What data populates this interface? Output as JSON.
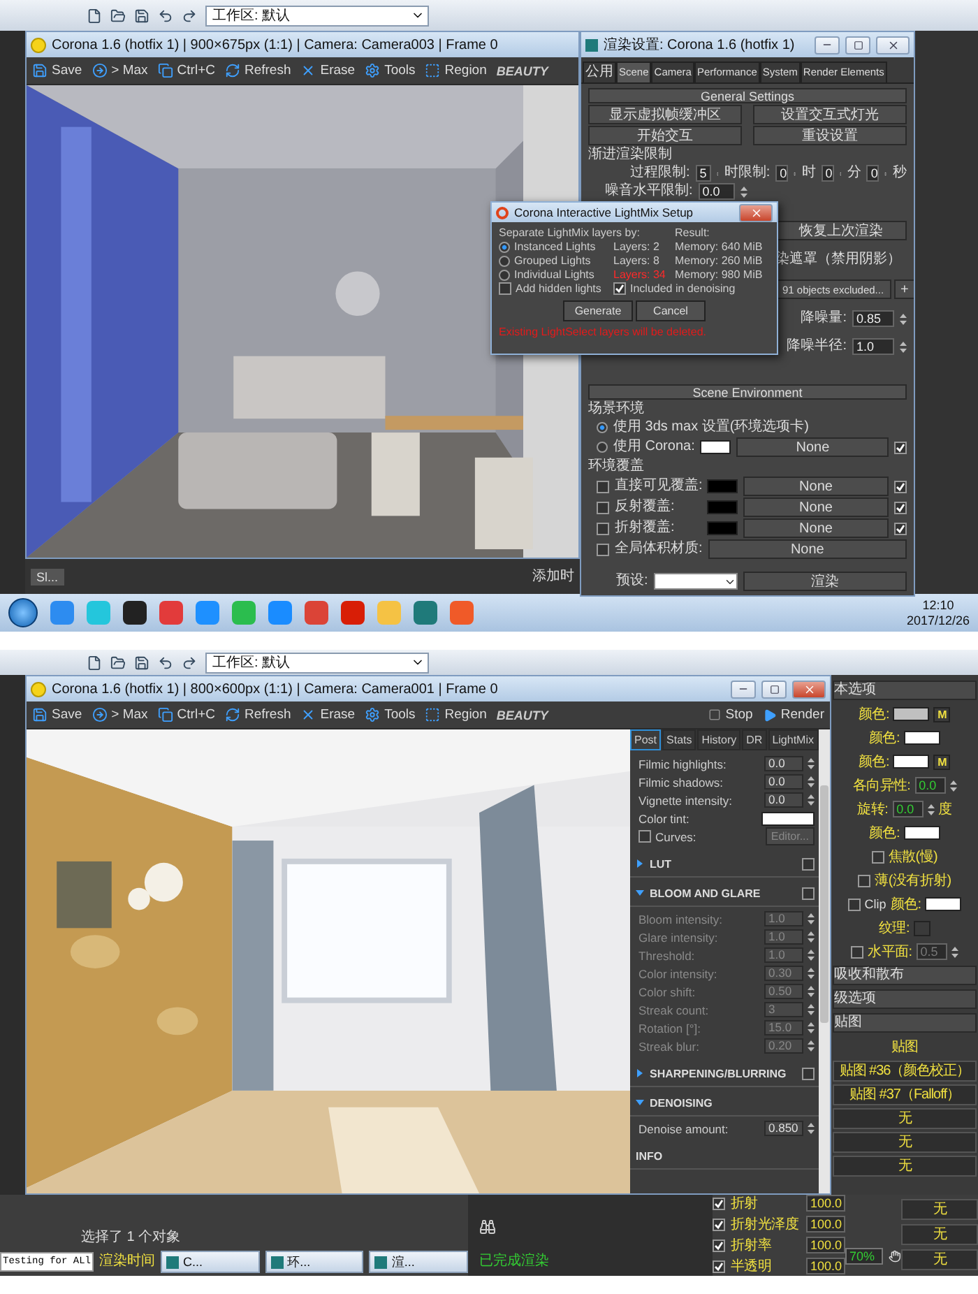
{
  "top_screen": {
    "workspace": "工作区: 默认",
    "vfb": {
      "title": "Corona 1.6 (hotfix 1) | 900×675px (1:1) | Camera: Camera003 | Frame 0",
      "toolbar": [
        {
          "kind": "save",
          "label": "Save"
        },
        {
          "kind": "max",
          "label": "> Max"
        },
        {
          "kind": "copy",
          "label": "Ctrl+C"
        },
        {
          "kind": "refresh",
          "label": "Refresh"
        },
        {
          "kind": "erase",
          "label": "Erase"
        },
        {
          "kind": "tools",
          "label": "Tools"
        },
        {
          "kind": "region",
          "label": "Region"
        }
      ],
      "channel": "BEAUTY"
    },
    "status": {
      "left_tab": "Sl...",
      "right_label": "添加时"
    },
    "render_setup": {
      "title": "渲染设置: Corona 1.6 (hotfix 1)",
      "tabs": [
        {
          "label": "公用",
          "selected": false
        },
        {
          "label": "Scene",
          "selected": true
        },
        {
          "label": "Camera",
          "selected": false
        },
        {
          "label": "Performance",
          "selected": false
        },
        {
          "label": "System",
          "selected": false
        },
        {
          "label": "Render Elements",
          "selected": false
        }
      ],
      "general": {
        "heading": "General Settings",
        "buttons": [
          "显示虚拟帧缓冲区",
          "设置交互式灯光",
          "开始交互",
          "重设设置"
        ],
        "limits_label": "渐进渲染限制",
        "pass_label": "过程限制:",
        "pass_value": "5",
        "time_label": "时限制:",
        "time_fields": [
          {
            "value": "0",
            "unit": "时"
          },
          {
            "value": "0",
            "unit": "分"
          },
          {
            "value": "0",
            "unit": "秒"
          }
        ],
        "noise_label": "噪音水平限制:",
        "noise_value": "0.0",
        "restore_button": "恢复上次渲染",
        "mask_label": "染遮罩（禁用阴影）",
        "excluded_button": "91 objects excluded...",
        "add_button": "+",
        "denoise": [
          {
            "label": "降噪量:",
            "value": "0.85"
          },
          {
            "label": "降噪半径:",
            "value": "1.0"
          }
        ]
      },
      "environment": {
        "heading": "Scene Environment",
        "group_label": "场景环境",
        "options": [
          {
            "label": "使用 3ds max 设置(环境选项卡)",
            "selected": true
          },
          {
            "label": "使用 Corona:",
            "selected": false
          }
        ],
        "corona_map": "None",
        "corona_map_checked": true,
        "override_label": "环境覆盖",
        "overrides": [
          {
            "label": "直接可见覆盖:",
            "checked": false,
            "map": "None",
            "map_checked": true
          },
          {
            "label": "反射覆盖:",
            "checked": false,
            "map": "None",
            "map_checked": true
          },
          {
            "label": "折射覆盖:",
            "checked": false,
            "map": "None",
            "map_checked": true
          }
        ],
        "volume": {
          "label": "全局体积材质:",
          "checked": false,
          "map": "None"
        }
      },
      "preset_label": "预设:",
      "render_button": "渲染"
    },
    "dialog": {
      "title": "Corona Interactive LightMix Setup",
      "prompt": "Separate LightMix layers by:",
      "result_label": "Result:",
      "options": [
        {
          "label": "Instanced Lights",
          "selected": true,
          "layers": "Layers: 2",
          "memory": "Memory: 640 MiB",
          "warning": false
        },
        {
          "label": "Grouped Lights",
          "selected": false,
          "layers": "Layers: 8",
          "memory": "Memory: 260 MiB",
          "warning": false
        },
        {
          "label": "Individual Lights",
          "selected": false,
          "layers": "Layers: 34",
          "memory": "Memory: 980 MiB",
          "warning": true
        }
      ],
      "add_hidden": {
        "label": "Add hidden lights",
        "checked": false
      },
      "denoising": {
        "label": "Included in denoising",
        "checked": true
      },
      "buttons": [
        "Generate",
        "Cancel"
      ],
      "message": "Existing LightSelect layers will be deleted."
    },
    "taskbar": {
      "time": "12:10",
      "date": "2017/12/26"
    }
  },
  "bottom_screen": {
    "workspace": "工作区: 默认",
    "vfb": {
      "title": "Corona 1.6 (hotfix 1) | 800×600px (1:1) | Camera: Camera001 | Frame 0",
      "toolbar": [
        {
          "kind": "save",
          "label": "Save"
        },
        {
          "kind": "max",
          "label": "> Max"
        },
        {
          "kind": "copy",
          "label": "Ctrl+C"
        },
        {
          "kind": "refresh",
          "label": "Refresh"
        },
        {
          "kind": "erase",
          "label": "Erase"
        },
        {
          "kind": "tools",
          "label": "Tools"
        },
        {
          "kind": "region",
          "label": "Region"
        }
      ],
      "channel": "BEAUTY",
      "stop_button": "Stop",
      "render_button": "Render",
      "tabs": [
        {
          "label": "Post",
          "selected": true
        },
        {
          "label": "Stats",
          "selected": false
        },
        {
          "label": "History",
          "selected": false
        },
        {
          "label": "DR",
          "selected": false
        },
        {
          "label": "LightMix",
          "selected": false
        }
      ],
      "rows": [
        {
          "kind": "spinner",
          "label": "Filmic highlights:",
          "value": "0.0"
        },
        {
          "kind": "spinner",
          "label": "Filmic shadows:",
          "value": "0.0"
        },
        {
          "kind": "spinner",
          "label": "Vignette intensity:",
          "value": "0.0"
        },
        {
          "kind": "swatch",
          "label": "Color tint:"
        },
        {
          "kind": "checkbox",
          "label": "Curves:",
          "checked": false,
          "button": "Editor..."
        }
      ],
      "sections": [
        {
          "title": "LUT",
          "expanded": false,
          "checked": false
        },
        {
          "title": "BLOOM AND GLARE",
          "expanded": true,
          "checked": false,
          "rows": [
            {
              "label": "Bloom intensity:",
              "value": "1.0"
            },
            {
              "label": "Glare intensity:",
              "value": "1.0"
            },
            {
              "label": "Threshold:",
              "value": "1.0"
            },
            {
              "label": "Color intensity:",
              "value": "0.30"
            },
            {
              "label": "Color shift:",
              "value": "0.50"
            },
            {
              "label": "Streak count:",
              "value": "3"
            },
            {
              "label": "Rotation [°]:",
              "value": "15.0"
            },
            {
              "label": "Streak blur:",
              "value": "0.20"
            }
          ]
        },
        {
          "title": "SHARPENING/BLURRING",
          "expanded": false,
          "checked": false
        },
        {
          "title": "DENOISING",
          "expanded": true,
          "rows": [
            {
              "label": "Denoise amount:",
              "value": "0.850"
            }
          ]
        }
      ],
      "info_label": "INFO"
    },
    "material": [
      {
        "kind": "header",
        "label": "本选项"
      },
      {
        "kind": "color",
        "label": "颜色:",
        "color": "#c0c0c0",
        "map": "M"
      },
      {
        "kind": "color",
        "label": "颜色:",
        "color": "#ffffff"
      },
      {
        "kind": "color",
        "label": "颜色:",
        "color": "#ffffff",
        "map": "M"
      },
      {
        "kind": "spin",
        "label": "各向异性:",
        "value": "0.0"
      },
      {
        "kind": "spin",
        "label": "旋转:",
        "value": "0.0",
        "unit": "度"
      },
      {
        "kind": "color",
        "label": "颜色:",
        "color": "#ffffff"
      },
      {
        "kind": "check",
        "label": "焦散(慢)",
        "checked": false
      },
      {
        "kind": "check",
        "label": "薄(没有折射)",
        "checked": false
      },
      {
        "kind": "color",
        "label": "颜色:",
        "color": "#ffffff",
        "prefix": "Clip",
        "checked": false
      },
      {
        "kind": "map",
        "label": "纹理:"
      },
      {
        "kind": "spin",
        "label": "水平面:",
        "value": "0.5",
        "checked": false
      },
      {
        "kind": "header",
        "label": "吸收和散布"
      },
      {
        "kind": "header",
        "label": "级选项"
      },
      {
        "kind": "header",
        "label": "贴图"
      },
      {
        "kind": "title",
        "label": "贴图"
      },
      {
        "kind": "slot",
        "label": "贴图 #36（颜色校正）"
      },
      {
        "kind": "slot",
        "label": "贴图 #37（Falloff）"
      },
      {
        "kind": "slot",
        "label": "无"
      },
      {
        "kind": "slot",
        "label": "无"
      },
      {
        "kind": "slot",
        "label": "无"
      }
    ],
    "status": {
      "selection": "选择了 1 个对象",
      "render_time": "渲染时间",
      "testing": "Testing for ALl",
      "tasks": [
        "C...",
        "环...",
        "渲..."
      ],
      "message": "已完成渲染",
      "zoom": "70%"
    },
    "channels": [
      {
        "label": "折射",
        "checked": true,
        "value": "100.0"
      },
      {
        "label": "折射光泽度",
        "checked": true,
        "value": "100.0"
      },
      {
        "label": "折射率",
        "checked": true,
        "value": "100.0"
      },
      {
        "label": "半透明",
        "checked": true,
        "value": "100.0"
      }
    ],
    "extra_slots": [
      "无",
      "无",
      "无"
    ]
  }
}
